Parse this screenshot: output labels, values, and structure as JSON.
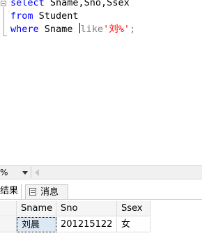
{
  "editor": {
    "line1": {
      "kw": "select",
      "rest": " Sname,Sno,Ssex"
    },
    "line2": {
      "kw": "from",
      "rest": " Student"
    },
    "line3": {
      "kw": "where",
      "mid": " Sname ",
      "like": "like",
      "str": "'刘%'",
      "end": ";"
    }
  },
  "zoom": {
    "value": "%"
  },
  "tabs": {
    "results": "结果",
    "messages": "消息"
  },
  "grid": {
    "columns": [
      "Sname",
      "Sno",
      "Ssex"
    ],
    "rows": [
      [
        "刘晨",
        "201215122",
        "女"
      ]
    ]
  },
  "colors": {
    "keyword": "#0000ff",
    "string": "#ff0000",
    "operator": "#808080",
    "selected_cell": "#dde8f5"
  }
}
